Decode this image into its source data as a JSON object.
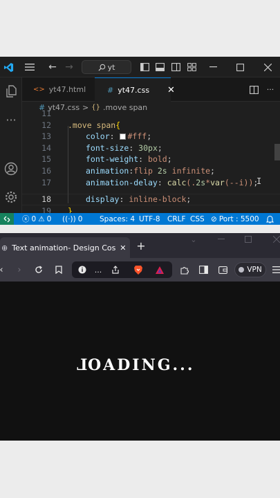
{
  "vscode": {
    "search_text": "yt",
    "tabs": [
      {
        "label": "yt47.html",
        "active": false
      },
      {
        "label": "yt47.css",
        "active": true
      }
    ],
    "breadcrumb": {
      "file": "yt47.css",
      "selector": ".move span"
    },
    "code_lines": [
      {
        "num": "11",
        "text": ""
      },
      {
        "num": "12",
        "text": ".move span{"
      },
      {
        "num": "13",
        "text": "color: #fff;"
      },
      {
        "num": "14",
        "text": "font-size: 30px;"
      },
      {
        "num": "15",
        "text": "font-weight: bold;"
      },
      {
        "num": "16",
        "text": "animation:flip 2s infinite;"
      },
      {
        "num": "17",
        "text": "animation-delay: calc(.2s*var(--i));"
      },
      {
        "num": "18",
        "text": "display: inline-block;"
      },
      {
        "num": "19",
        "text": "}"
      }
    ],
    "current_line": "18",
    "statusbar": {
      "errors": "0",
      "warnings": "0",
      "ports": "0",
      "spaces": "Spaces: 4",
      "encoding": "UTF-8",
      "eol": "CRLF",
      "language": "CSS",
      "port": "Port : 5500"
    },
    "colors": {
      "accent": "#0078d4",
      "remote": "#16825d",
      "background": "#1f1f1f"
    }
  },
  "browser": {
    "tab_title": "Text animation- Design Cosm",
    "vpn_label": "VPN",
    "page_text": "LOADING...",
    "colors": {
      "content_bg": "#111111",
      "text": "#ffffff"
    }
  }
}
